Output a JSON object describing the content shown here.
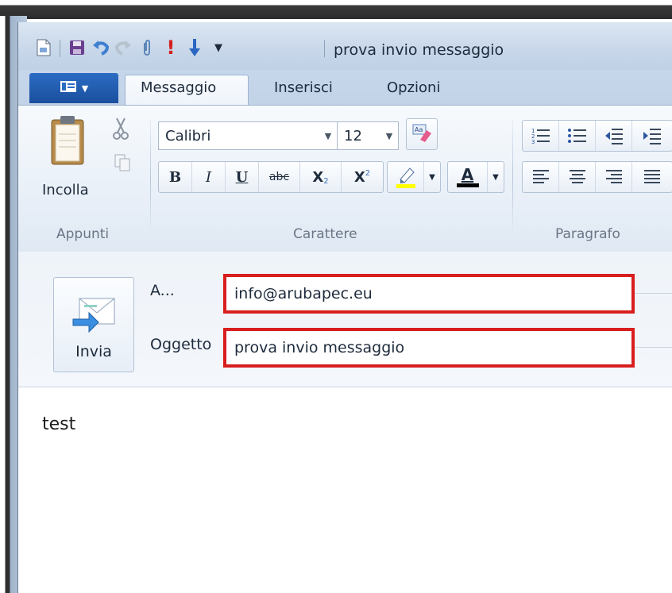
{
  "window": {
    "title": "prova invio messaggio"
  },
  "quick_access": {
    "icons": [
      "new-icon",
      "save-icon",
      "undo-icon",
      "redo-icon",
      "attach-icon",
      "importance-high-icon",
      "importance-low-icon",
      "customize-icon"
    ]
  },
  "tabs": {
    "items": [
      {
        "label": "Messaggio",
        "selected": true
      },
      {
        "label": "Inserisci",
        "selected": false
      },
      {
        "label": "Opzioni",
        "selected": false
      }
    ]
  },
  "ribbon": {
    "clipboard": {
      "paste_label": "Incolla",
      "group_label": "Appunti"
    },
    "font": {
      "family": "Calibri",
      "size": "12",
      "group_label": "Carattere",
      "bold": "B",
      "italic": "I",
      "underline": "U",
      "strike": "abc",
      "subscript": "X",
      "superscript": "X",
      "font_color_letter": "A"
    },
    "paragraph": {
      "group_label": "Paragrafo"
    }
  },
  "compose": {
    "send_label": "Invia",
    "to_label": "A...",
    "to_value": "info@arubapec.eu",
    "subject_label": "Oggetto",
    "subject_value": "prova invio messaggio",
    "body": "test"
  },
  "colors": {
    "highlight_border": "#d81e1e",
    "file_tab": "#1a4f9e",
    "highlighter": "#ffff00",
    "font_color": "#000000"
  }
}
